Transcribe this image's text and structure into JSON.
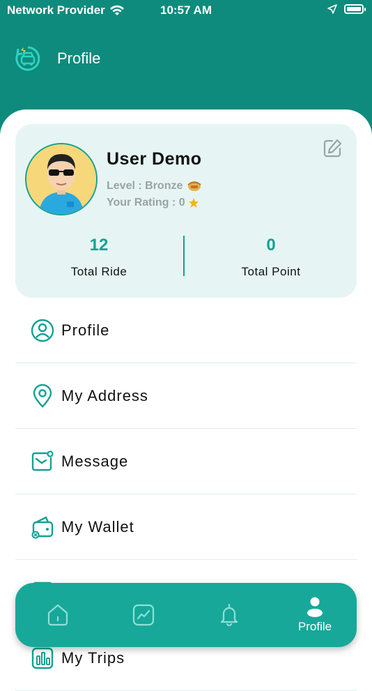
{
  "status_bar": {
    "carrier": "Network Provider",
    "time": "10:57 AM"
  },
  "header": {
    "title": "Profile"
  },
  "profile": {
    "name": "User Demo",
    "level_text": "Level : Bronze",
    "rating_text": "Your Rating : 0",
    "stats": [
      {
        "value": "12",
        "label": "Total Ride"
      },
      {
        "value": "0",
        "label": "Total Point"
      }
    ]
  },
  "menu": {
    "items": [
      {
        "label": "Profile",
        "icon": "user-circle-icon"
      },
      {
        "label": "My Address",
        "icon": "location-pin-icon"
      },
      {
        "label": "Message",
        "icon": "message-icon"
      },
      {
        "label": "My Wallet",
        "icon": "wallet-icon"
      },
      {
        "label": "",
        "icon": "document-icon"
      },
      {
        "label": "My Trips",
        "icon": "trips-icon"
      }
    ]
  },
  "bottom_nav": {
    "items": [
      {
        "label": "",
        "icon": "home-icon"
      },
      {
        "label": "",
        "icon": "chart-icon"
      },
      {
        "label": "",
        "icon": "bell-icon"
      },
      {
        "label": "Profile",
        "icon": "person-icon"
      }
    ],
    "active_index": 3
  },
  "colors": {
    "primary": "#0e8b7c",
    "accent": "#14a193",
    "card_bg": "#e6f5f3",
    "nav_bg": "#17a89a"
  }
}
